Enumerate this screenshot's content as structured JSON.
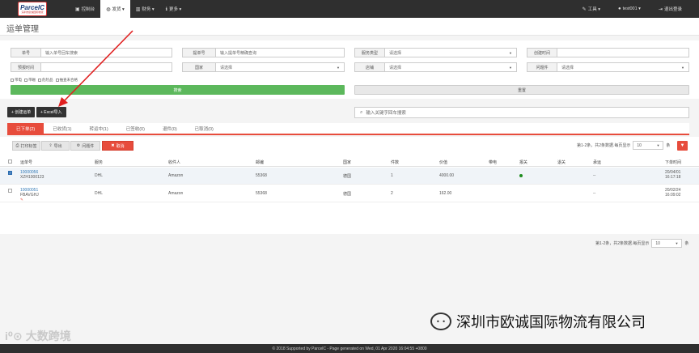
{
  "topbar": {
    "logo_main": "ParcelC",
    "logo_sub": "深圳市欧诚国际物流",
    "nav": [
      {
        "icon": "home-icon",
        "glyph": "▣",
        "label": "控制台",
        "active": false
      },
      {
        "icon": "globe-icon",
        "glyph": "◍",
        "label": "发货 ▾",
        "active": true
      },
      {
        "icon": "barcode-icon",
        "glyph": "▥",
        "label": "财务 ▾",
        "active": false
      },
      {
        "icon": "info-icon",
        "glyph": "ℹ",
        "label": "更多 ▾",
        "active": false
      }
    ],
    "right": [
      {
        "icon": "wrench-icon",
        "glyph": "✎",
        "label": "工具 ▾"
      },
      {
        "icon": "user-icon",
        "glyph": "●",
        "label": "test001 ▾"
      },
      {
        "icon": "logout-icon",
        "glyph": "⇥",
        "label": "退出登录"
      }
    ]
  },
  "page_title": "运单管理",
  "filters": {
    "order_no": {
      "label": "单号",
      "placeholder": "输入单号回车搜索"
    },
    "bill_no": {
      "label": "提单号",
      "placeholder": "输入提单号精确查询"
    },
    "service_type": {
      "label": "服务类型",
      "value": "请选择"
    },
    "created_time": {
      "label": "创建时间",
      "value": ""
    },
    "forecast_time": {
      "label": "预报时间",
      "value": ""
    },
    "country": {
      "label": "国家",
      "value": "请选择"
    },
    "shop": {
      "label": "店铺",
      "value": "请选择"
    },
    "problem": {
      "label": "问题件",
      "value": "请选择"
    },
    "checkboxes": [
      "带电",
      "带磁",
      "危险品",
      "抽查未合格"
    ],
    "search_btn": "搜索",
    "reset_btn": "重置"
  },
  "actions": {
    "create_btn": "+ 创建运单",
    "import_btn": "+ Excel导入",
    "keyword_placeholder": "输入关键字回车搜索"
  },
  "tabs": [
    "已下单(2)",
    "已收货(1)",
    "转运中(1)",
    "已签收(0)",
    "退件(0)",
    "已取消(0)"
  ],
  "toolbar": {
    "print_btn": "打印标签",
    "export_btn": "导出",
    "problem_btn": "问题件",
    "cancel_btn": "取消",
    "pager_text": "第1-2条，共2条数据.每页显示",
    "page_size": "10",
    "page_unit": "条"
  },
  "table": {
    "headers": [
      "运单号",
      "服务",
      "收件人",
      "邮编",
      "国家",
      "件数",
      "价值",
      "带电",
      "报关",
      "退关",
      "承运",
      "下单时间"
    ],
    "rows": [
      {
        "selected": true,
        "waybill": "10000056",
        "sub": "XZH1000123",
        "service": "DHL",
        "recipient": "Amazon",
        "zip": "55368",
        "country": "德国",
        "count": "1",
        "value": "4000.00",
        "battery": "",
        "customs": "●",
        "return": "",
        "carrier": "--",
        "date": "20/04/01",
        "time": "16:17:18",
        "pencil": ""
      },
      {
        "selected": false,
        "waybill": "10000051",
        "sub": "FBAVGHJ",
        "service": "DHL",
        "recipient": "Amazon",
        "zip": "55368",
        "country": "德国",
        "count": "2",
        "value": "162.00",
        "battery": "",
        "customs": "",
        "return": "",
        "carrier": "--",
        "date": "20/02/24",
        "time": "16:09:02",
        "pencil": "✎"
      }
    ]
  },
  "bottom_pager": {
    "text": "第1-2条，共2条数据.每页显示",
    "page_size": "10",
    "page_unit": "条"
  },
  "watermark_left": "大数跨境",
  "watermark_right": "深圳市欧诚国际物流有限公司",
  "footer": "© 2018 Supported by ParcelC - Page generated on Wed, 01 Apr 2020 16:04:55 +0800",
  "colors": {
    "accent_red": "#e74c3c",
    "green": "#5cb85c",
    "dark": "#2f2f2f",
    "link": "#337ab7"
  }
}
